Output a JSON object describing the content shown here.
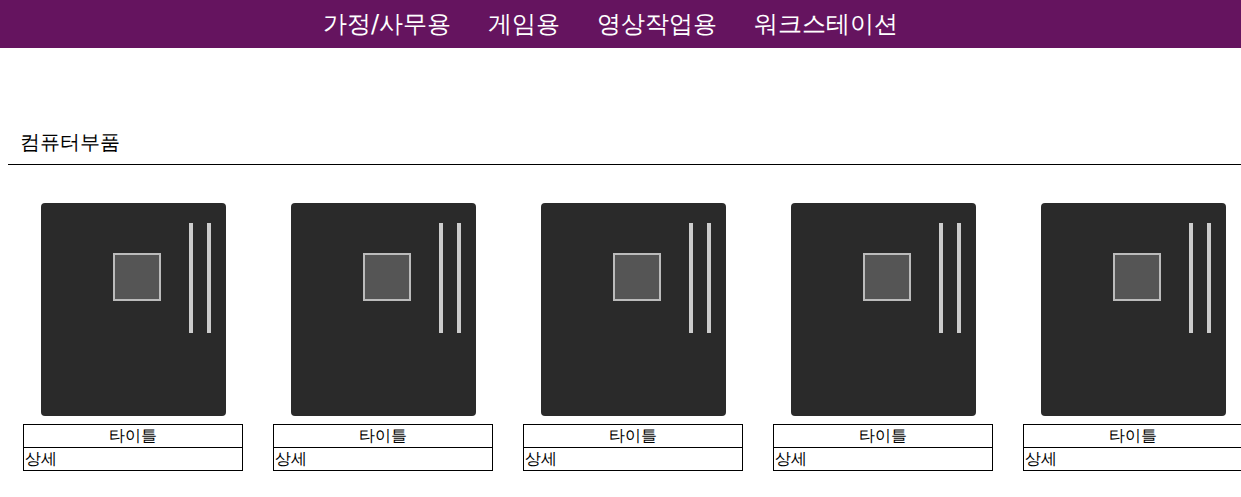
{
  "nav": {
    "items": [
      "가정/사무용",
      "게임용",
      "영상작업용",
      "워크스테이션"
    ]
  },
  "section": {
    "title": "컴퓨터부품"
  },
  "products": [
    {
      "title": "타이틀",
      "detail": "상세"
    },
    {
      "title": "타이틀",
      "detail": "상세"
    },
    {
      "title": "타이틀",
      "detail": "상세"
    },
    {
      "title": "타이틀",
      "detail": "상세"
    },
    {
      "title": "타이틀",
      "detail": "상세"
    }
  ]
}
